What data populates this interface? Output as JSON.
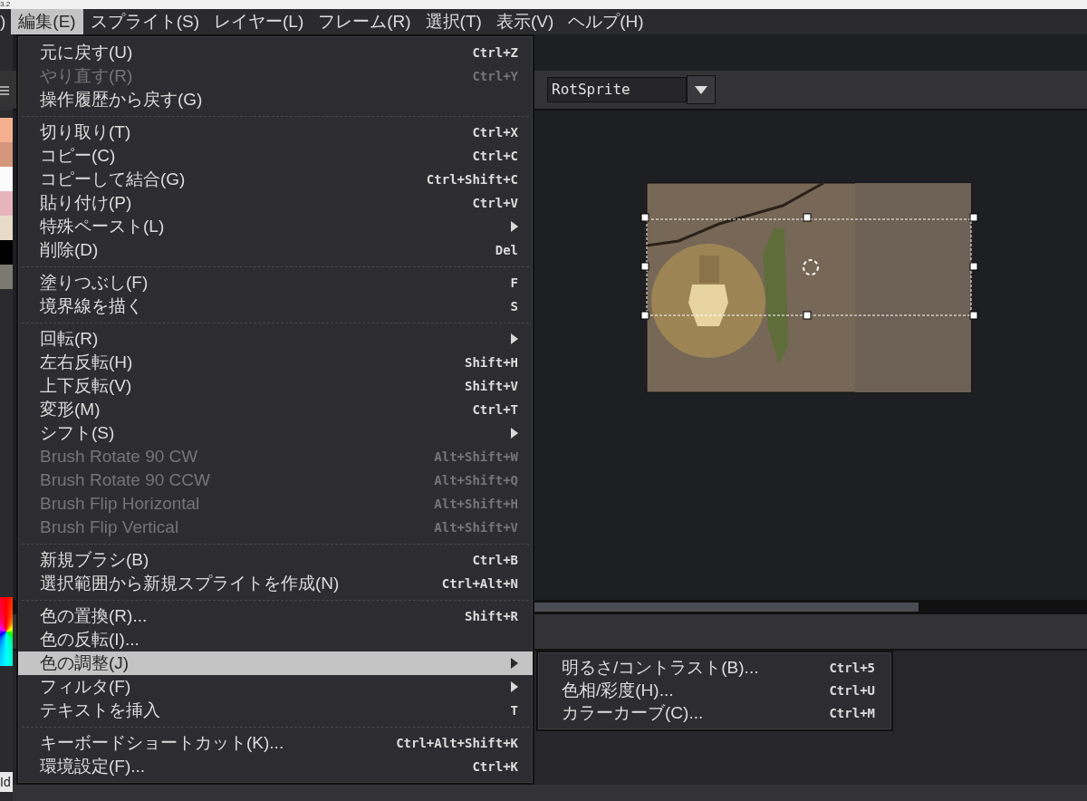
{
  "window": {
    "title": "3.2"
  },
  "menu_bar": [
    {
      "label": ")",
      "selected": false
    },
    {
      "label": "編集(E)",
      "selected": true
    },
    {
      "label": "スプライト(S)",
      "selected": false
    },
    {
      "label": "レイヤー(L)",
      "selected": false
    },
    {
      "label": "フレーム(R)",
      "selected": false
    },
    {
      "label": "選択(T)",
      "selected": false
    },
    {
      "label": "表示(V)",
      "selected": false
    },
    {
      "label": "ヘルプ(H)",
      "selected": false
    }
  ],
  "toolbar": {
    "rotation_algorithm": "RotSprite"
  },
  "palette": [
    {
      "color": "#f4b08e"
    },
    {
      "color": "#d4967a"
    },
    {
      "color": "#fbfbfb"
    },
    {
      "color": "#e8b4bc"
    },
    {
      "color": "#e8dcc8"
    },
    {
      "color": "#000000"
    },
    {
      "color": "#7a7a70"
    }
  ],
  "bottom_left_label": "Id",
  "edit_menu": [
    {
      "kind": "item",
      "label": "元に戻す(U)",
      "shortcut": "Ctrl+Z",
      "disabled": false,
      "selected": false,
      "submenu": false
    },
    {
      "kind": "item",
      "label": "やり直す(R)",
      "shortcut": "Ctrl+Y",
      "disabled": true,
      "selected": false,
      "submenu": false
    },
    {
      "kind": "item",
      "label": "操作履歴から戻す(G)",
      "disabled": false,
      "selected": false,
      "submenu": false
    },
    {
      "kind": "separator"
    },
    {
      "kind": "item",
      "label": "切り取り(T)",
      "shortcut": "Ctrl+X",
      "disabled": false,
      "selected": false,
      "submenu": false
    },
    {
      "kind": "item",
      "label": "コピー(C)",
      "shortcut": "Ctrl+C",
      "disabled": false,
      "selected": false,
      "submenu": false
    },
    {
      "kind": "item",
      "label": "コピーして結合(G)",
      "shortcut": "Ctrl+Shift+C",
      "disabled": false,
      "selected": false,
      "submenu": false
    },
    {
      "kind": "item",
      "label": "貼り付け(P)",
      "shortcut": "Ctrl+V",
      "disabled": false,
      "selected": false,
      "submenu": false
    },
    {
      "kind": "item",
      "label": "特殊ペースト(L)",
      "disabled": false,
      "selected": false,
      "submenu": true
    },
    {
      "kind": "item",
      "label": "削除(D)",
      "shortcut": "Del",
      "disabled": false,
      "selected": false,
      "submenu": false
    },
    {
      "kind": "separator"
    },
    {
      "kind": "item",
      "label": "塗りつぶし(F)",
      "shortcut": "F",
      "disabled": false,
      "selected": false,
      "submenu": false
    },
    {
      "kind": "item",
      "label": "境界線を描く",
      "shortcut": "S",
      "disabled": false,
      "selected": false,
      "submenu": false
    },
    {
      "kind": "separator"
    },
    {
      "kind": "item",
      "label": "回転(R)",
      "disabled": false,
      "selected": false,
      "submenu": true
    },
    {
      "kind": "item",
      "label": "左右反転(H)",
      "shortcut": "Shift+H",
      "disabled": false,
      "selected": false,
      "submenu": false
    },
    {
      "kind": "item",
      "label": "上下反転(V)",
      "shortcut": "Shift+V",
      "disabled": false,
      "selected": false,
      "submenu": false
    },
    {
      "kind": "item",
      "label": "変形(M)",
      "shortcut": "Ctrl+T",
      "disabled": false,
      "selected": false,
      "submenu": false
    },
    {
      "kind": "item",
      "label": "シフト(S)",
      "disabled": false,
      "selected": false,
      "submenu": true
    },
    {
      "kind": "item",
      "label": "Brush Rotate 90 CW",
      "shortcut": "Alt+Shift+W",
      "disabled": true,
      "selected": false,
      "submenu": false
    },
    {
      "kind": "item",
      "label": "Brush Rotate 90 CCW",
      "shortcut": "Alt+Shift+Q",
      "disabled": true,
      "selected": false,
      "submenu": false
    },
    {
      "kind": "item",
      "label": "Brush Flip Horizontal",
      "shortcut": "Alt+Shift+H",
      "disabled": true,
      "selected": false,
      "submenu": false
    },
    {
      "kind": "item",
      "label": "Brush Flip Vertical",
      "shortcut": "Alt+Shift+V",
      "disabled": true,
      "selected": false,
      "submenu": false
    },
    {
      "kind": "separator"
    },
    {
      "kind": "item",
      "label": "新規ブラシ(B)",
      "shortcut": "Ctrl+B",
      "disabled": false,
      "selected": false,
      "submenu": false
    },
    {
      "kind": "item",
      "label": "選択範囲から新規スプライトを作成(N)",
      "shortcut": "Ctrl+Alt+N",
      "disabled": false,
      "selected": false,
      "submenu": false
    },
    {
      "kind": "separator"
    },
    {
      "kind": "item",
      "label": "色の置換(R)...",
      "shortcut": "Shift+R",
      "disabled": false,
      "selected": false,
      "submenu": false
    },
    {
      "kind": "item",
      "label": "色の反転(I)...",
      "disabled": false,
      "selected": false,
      "submenu": false
    },
    {
      "kind": "item",
      "label": "色の調整(J)",
      "disabled": false,
      "selected": true,
      "submenu": true
    },
    {
      "kind": "item",
      "label": "フィルタ(F)",
      "disabled": false,
      "selected": false,
      "submenu": true
    },
    {
      "kind": "item",
      "label": "テキストを挿入",
      "shortcut": "T",
      "disabled": false,
      "selected": false,
      "submenu": false
    },
    {
      "kind": "separator"
    },
    {
      "kind": "item",
      "label": "キーボードショートカット(K)...",
      "shortcut": "Ctrl+Alt+Shift+K",
      "disabled": false,
      "selected": false,
      "submenu": false
    },
    {
      "kind": "item",
      "label": "環境設定(F)...",
      "shortcut": "Ctrl+K",
      "disabled": false,
      "selected": false,
      "submenu": false
    }
  ],
  "color_adjust_submenu": [
    {
      "label": "明るさ/コントラスト(B)...",
      "shortcut": "Ctrl+5"
    },
    {
      "label": "色相/彩度(H)...",
      "shortcut": "Ctrl+U"
    },
    {
      "label": "カラーカーブ(C)...",
      "shortcut": "Ctrl+M"
    }
  ]
}
